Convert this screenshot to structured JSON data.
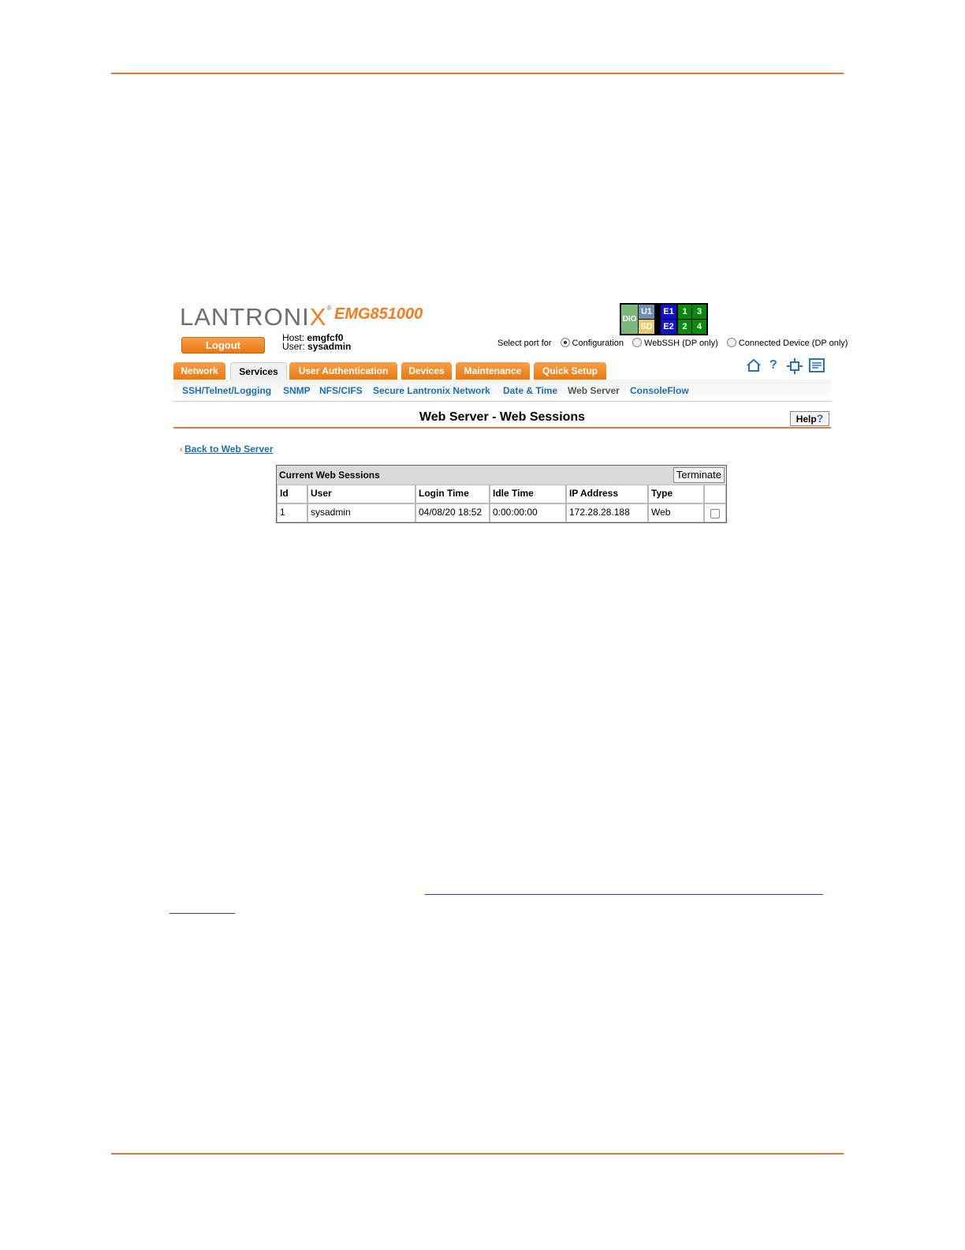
{
  "brand": {
    "logo_main": "LANTRONI",
    "logo_x": "X",
    "trademark": "®",
    "model": "EMG851000"
  },
  "logout_label": "Logout",
  "host": {
    "host_label": "Host:",
    "host_value": "emgfcf0",
    "user_label": "User:",
    "user_value": "sysadmin"
  },
  "ports": {
    "dio": "DIO",
    "u1": "U1",
    "sd": "SD",
    "e1": "E1",
    "e2": "E2",
    "p1": "1",
    "p2": "2",
    "p3": "3",
    "p4": "4"
  },
  "select_port": {
    "label": "Select port for",
    "options": [
      "Configuration",
      "WebSSH (DP only)",
      "Connected Device (DP only)"
    ],
    "selected": "Configuration"
  },
  "tabs": [
    "Network",
    "Services",
    "User Authentication",
    "Devices",
    "Maintenance",
    "Quick Setup"
  ],
  "active_tab": "Services",
  "subnav": [
    "SSH/Telnet/Logging",
    "SNMP",
    "NFS/CIFS",
    "Secure Lantronix Network",
    "Date & Time",
    "Web Server",
    "ConsoleFlow"
  ],
  "active_subnav": "Web Server",
  "page_title": "Web Server - Web Sessions",
  "help_label": "Help",
  "back_link": "Back to Web Server",
  "sessions": {
    "title": "Current Web Sessions",
    "terminate_label": "Terminate",
    "columns": [
      "Id",
      "User",
      "Login Time",
      "Idle Time",
      "IP Address",
      "Type"
    ],
    "rows": [
      {
        "id": "1",
        "user": "sysadmin",
        "login_time": "04/08/20 18:52",
        "idle_time": "0:00:00:00",
        "ip": "172.28.28.188",
        "type": "Web"
      }
    ]
  },
  "icons": [
    "home-icon",
    "help-icon",
    "network-icon",
    "log-icon"
  ],
  "colors": {
    "accent": "#f47b20",
    "link": "#1a6fb7",
    "rule": "#e07b39"
  }
}
